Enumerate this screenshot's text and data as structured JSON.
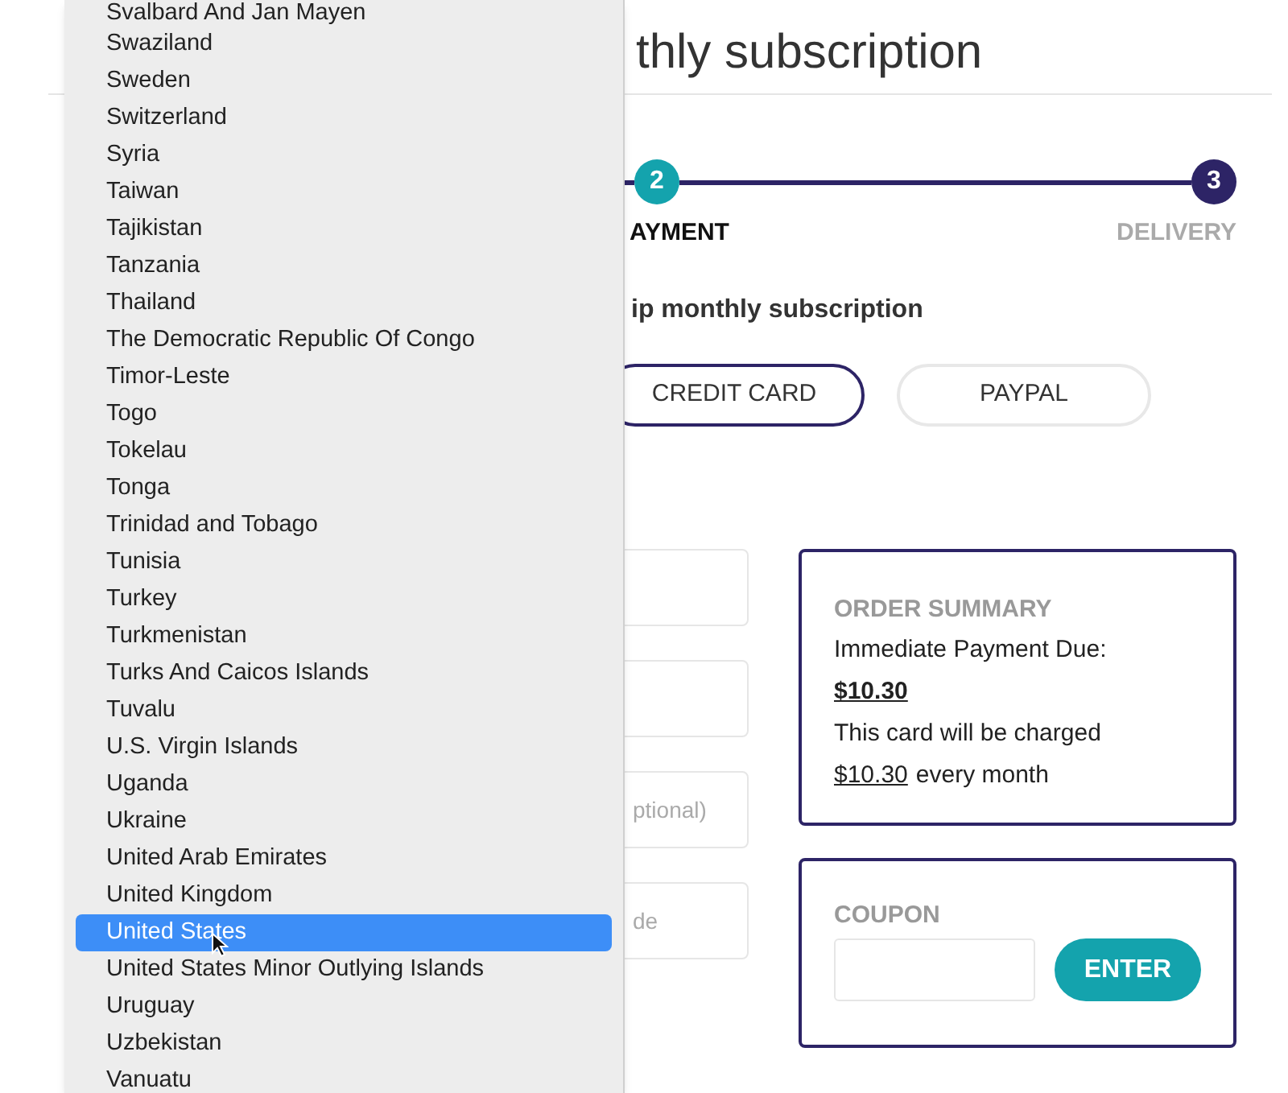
{
  "header": {
    "title_end": "thly subscription"
  },
  "stepper": {
    "steps": [
      {
        "number": "2",
        "label": "AYMENT",
        "selected": true
      },
      {
        "number": "3",
        "label": "DELIVERY",
        "selected": false
      }
    ]
  },
  "subtitle": "ip monthly subscription",
  "payment_methods": [
    {
      "label": "CREDIT CARD",
      "selected": true
    },
    {
      "label": "PAYPAL",
      "selected": false
    }
  ],
  "fields": [
    {
      "kind": "text"
    },
    {
      "kind": "text"
    },
    {
      "kind": "text",
      "placeholder": "ptional)"
    },
    {
      "kind": "text",
      "placeholder": "de"
    }
  ],
  "order_summary": {
    "title": "ORDER SUMMARY",
    "due_label": "Immediate Payment Due:",
    "due_amount": "$10.30",
    "charge_text": "This card will be charged",
    "charge_amount": "$10.30",
    "charge_period": "every month"
  },
  "coupon": {
    "title": "COUPON",
    "button": "ENTER"
  },
  "country_dropdown": {
    "items": [
      {
        "label": "Svalbard And Jan Mayen",
        "selected": false
      },
      {
        "label": "Swaziland",
        "selected": false
      },
      {
        "label": "Sweden",
        "selected": false
      },
      {
        "label": "Switzerland",
        "selected": false
      },
      {
        "label": "Syria",
        "selected": false
      },
      {
        "label": "Taiwan",
        "selected": false
      },
      {
        "label": "Tajikistan",
        "selected": false
      },
      {
        "label": "Tanzania",
        "selected": false
      },
      {
        "label": "Thailand",
        "selected": false
      },
      {
        "label": "The Democratic Republic Of Congo",
        "selected": false
      },
      {
        "label": "Timor-Leste",
        "selected": false
      },
      {
        "label": "Togo",
        "selected": false
      },
      {
        "label": "Tokelau",
        "selected": false
      },
      {
        "label": "Tonga",
        "selected": false
      },
      {
        "label": "Trinidad and Tobago",
        "selected": false
      },
      {
        "label": "Tunisia",
        "selected": false
      },
      {
        "label": "Turkey",
        "selected": false
      },
      {
        "label": "Turkmenistan",
        "selected": false
      },
      {
        "label": "Turks And Caicos Islands",
        "selected": false
      },
      {
        "label": "Tuvalu",
        "selected": false
      },
      {
        "label": "U.S. Virgin Islands",
        "selected": false
      },
      {
        "label": "Uganda",
        "selected": false
      },
      {
        "label": "Ukraine",
        "selected": false
      },
      {
        "label": "United Arab Emirates",
        "selected": false
      },
      {
        "label": "United Kingdom",
        "selected": false
      },
      {
        "label": "United States",
        "selected": true
      },
      {
        "label": "United States Minor Outlying Islands",
        "selected": false
      },
      {
        "label": "Uruguay",
        "selected": false
      },
      {
        "label": "Uzbekistan",
        "selected": false
      },
      {
        "label": "Vanuatu",
        "selected": false
      }
    ]
  }
}
